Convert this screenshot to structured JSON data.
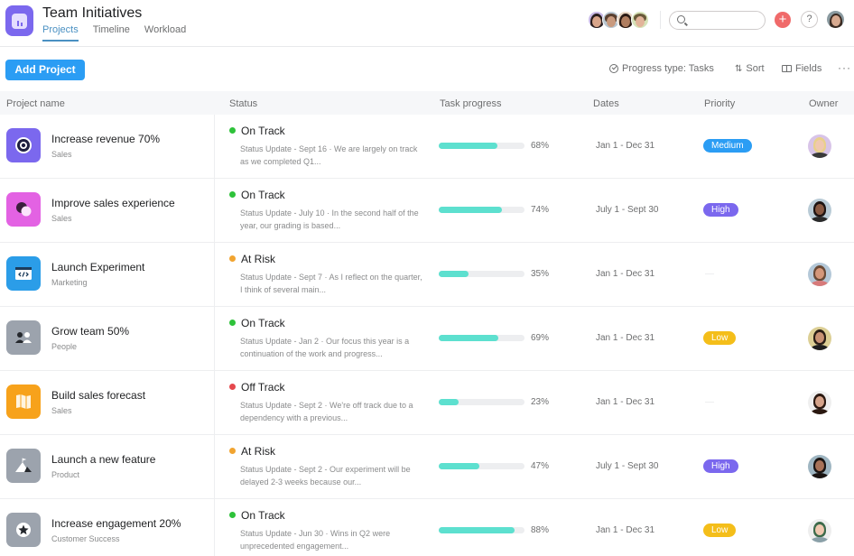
{
  "header": {
    "title": "Team Initiatives",
    "tabs": [
      {
        "label": "Projects",
        "active": true
      },
      {
        "label": "Timeline",
        "active": false
      },
      {
        "label": "Workload",
        "active": false
      }
    ],
    "members_count_shown": 4,
    "search": {
      "placeholder": "",
      "value": ""
    },
    "add_symbol": "+",
    "help_symbol": "?"
  },
  "toolbar": {
    "add_project_label": "Add Project",
    "progress_type_label": "Progress type: Tasks",
    "sort_label": "Sort",
    "fields_label": "Fields",
    "more_symbol": "···"
  },
  "table": {
    "columns": [
      "Project name",
      "Status",
      "Task progress",
      "Dates",
      "Priority",
      "Owner"
    ],
    "rows": [
      {
        "name": "Increase revenue 70%",
        "team": "Sales",
        "icon": "target-icon",
        "icon_color": "#7b68ee",
        "status": "On Track",
        "status_color": "#2ec23a",
        "update": "Status Update - Sept 16 · We are largely on track as we completed Q1...",
        "progress_pct": 68,
        "progress_label": "68%",
        "dates": "Jan 1 - Dec 31",
        "priority": "Medium",
        "priority_color": "#2b9df4"
      },
      {
        "name": "Improve sales experience",
        "team": "Sales",
        "icon": "chat-bubbles-icon",
        "icon_color": "#e362e3",
        "status": "On Track",
        "status_color": "#2ec23a",
        "update": "Status Update - July 10 · In the second half of the year, our grading is based...",
        "progress_pct": 74,
        "progress_label": "74%",
        "dates": "July 1 - Sept 30",
        "priority": "High",
        "priority_color": "#7b68ee"
      },
      {
        "name": "Launch Experiment",
        "team": "Marketing",
        "icon": "code-window-icon",
        "icon_color": "#2b9de8",
        "status": "At Risk",
        "status_color": "#f1a430",
        "update": "Status Update - Sept 7 · As I reflect on the quarter, I think of several main...",
        "progress_pct": 35,
        "progress_label": "35%",
        "dates": "Jan 1 - Dec 31",
        "priority": "",
        "priority_color": ""
      },
      {
        "name": "Grow team 50%",
        "team": "People",
        "icon": "people-icon",
        "icon_color": "#9ca3ad",
        "status": "On Track",
        "status_color": "#2ec23a",
        "update": "Status Update - Jan 2 · Our focus this year is a continuation of the work and progress...",
        "progress_pct": 69,
        "progress_label": "69%",
        "dates": "Jan 1 - Dec 31",
        "priority": "Low",
        "priority_color": "#f4be1a"
      },
      {
        "name": "Build sales forecast",
        "team": "Sales",
        "icon": "map-icon",
        "icon_color": "#f7a21b",
        "status": "Off Track",
        "status_color": "#e5484d",
        "update": "Status Update - Sept 2 · We're off track due to a dependency with a previous...",
        "progress_pct": 23,
        "progress_label": "23%",
        "dates": "Jan 1 - Dec 31",
        "priority": "",
        "priority_color": ""
      },
      {
        "name": "Launch a new feature",
        "team": "Product",
        "icon": "mountain-flag-icon",
        "icon_color": "#9ca3ad",
        "status": "At Risk",
        "status_color": "#f1a430",
        "update": "Status Update - Sept 2 - Our experiment will be delayed 2-3 weeks because our...",
        "progress_pct": 47,
        "progress_label": "47%",
        "dates": "July 1 - Sept 30",
        "priority": "High",
        "priority_color": "#7b68ee"
      },
      {
        "name": "Increase engagement 20%",
        "team": "Customer Success",
        "icon": "star-icon",
        "icon_color": "#9ca3ad",
        "status": "On Track",
        "status_color": "#2ec23a",
        "update": "Status Update - Jun 30 · Wins in Q2 were unprecedented engagement...",
        "progress_pct": 88,
        "progress_label": "88%",
        "dates": "Jan 1 - Dec 31",
        "priority": "Low",
        "priority_color": "#f4be1a"
      }
    ]
  }
}
